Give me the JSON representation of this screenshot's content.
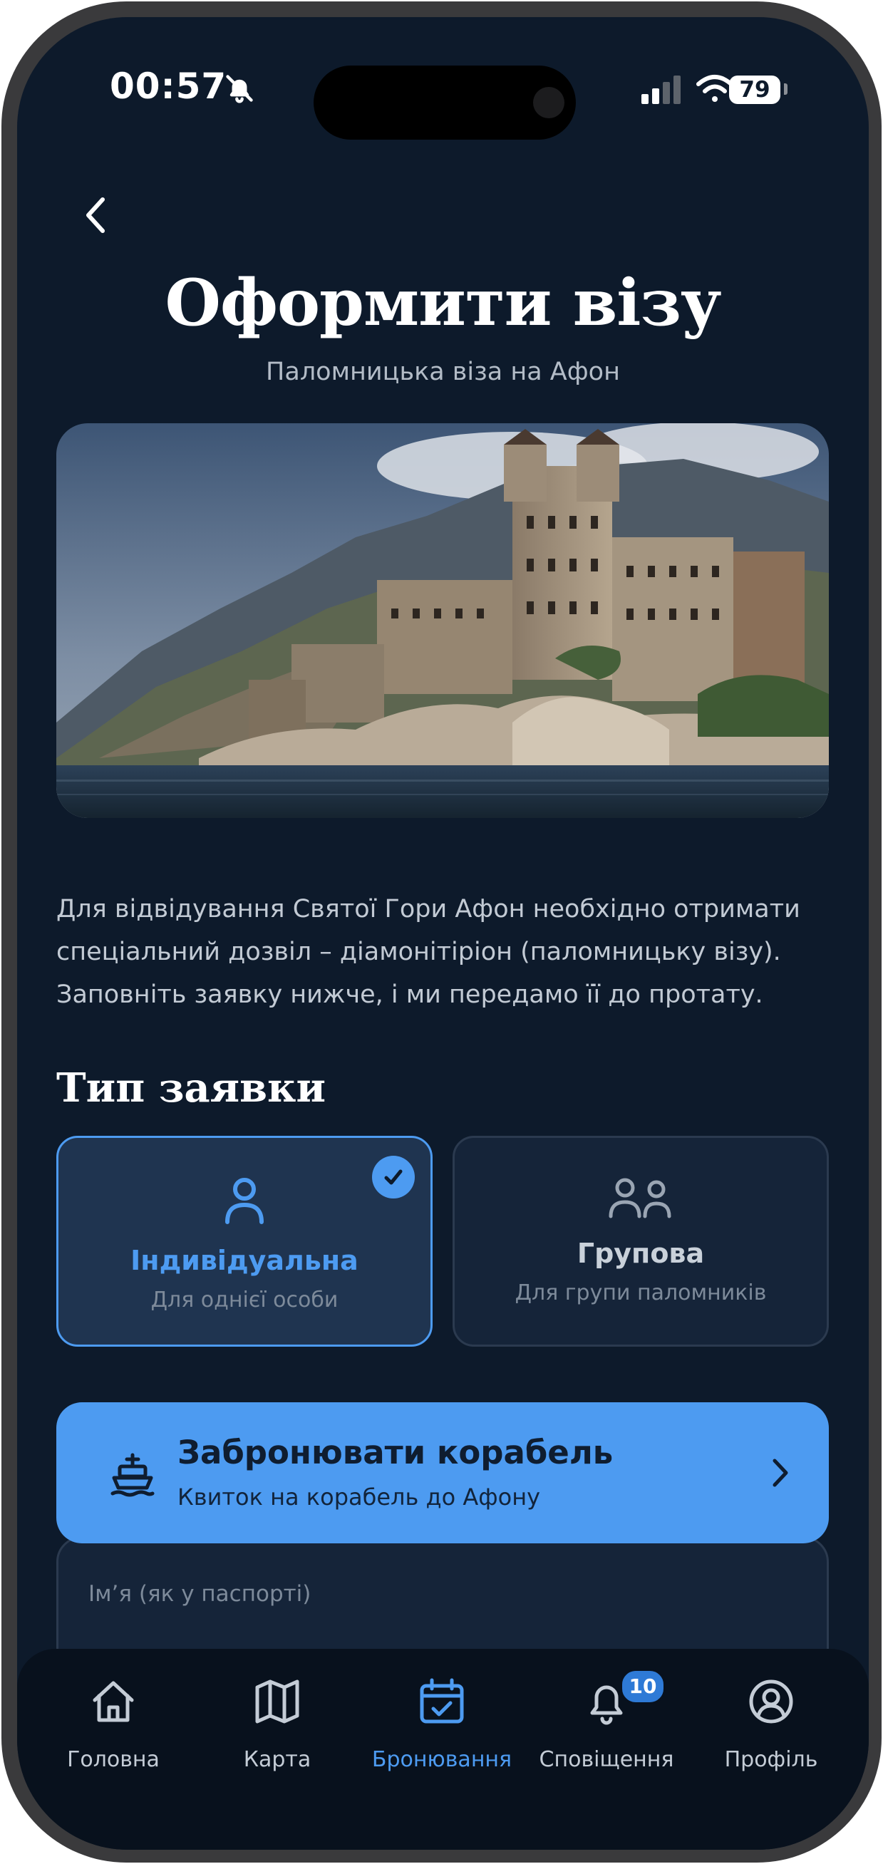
{
  "status_bar": {
    "time": "00:57",
    "battery": "79"
  },
  "header": {
    "title": "Оформити візу",
    "subtitle": "Паломницька віза на Афон"
  },
  "description": "Для відвідування Святої Гори Афон необхідно отримати спеціальний дозвіл – діамонітіріон (паломницьку візу). Заповніть заявку нижче, і ми передамо її до протату.",
  "application_type": {
    "heading": "Тип заявки",
    "options": [
      {
        "title": "Індивідуальна",
        "subtitle": "Для однієї особи",
        "selected": true
      },
      {
        "title": "Групова",
        "subtitle": "Для групи паломників",
        "selected": false
      }
    ]
  },
  "ship_booking": {
    "title": "Забронювати корабель",
    "subtitle": "Квиток на корабель до Афону"
  },
  "form": {
    "name_placeholder": "Ім’я (як у паспорті)"
  },
  "tabbar": {
    "items": [
      {
        "label": "Головна",
        "icon": "home-icon"
      },
      {
        "label": "Карта",
        "icon": "map-icon"
      },
      {
        "label": "Бронювання",
        "icon": "calendar-check-icon",
        "active": true
      },
      {
        "label": "Сповіщення",
        "icon": "bell-icon",
        "badge": "10"
      },
      {
        "label": "Профіль",
        "icon": "user-circle-icon"
      }
    ]
  },
  "colors": {
    "background": "#0d1a2b",
    "accent": "#4d9bf1",
    "card": "#152439",
    "selected_card": "#1f3450"
  }
}
